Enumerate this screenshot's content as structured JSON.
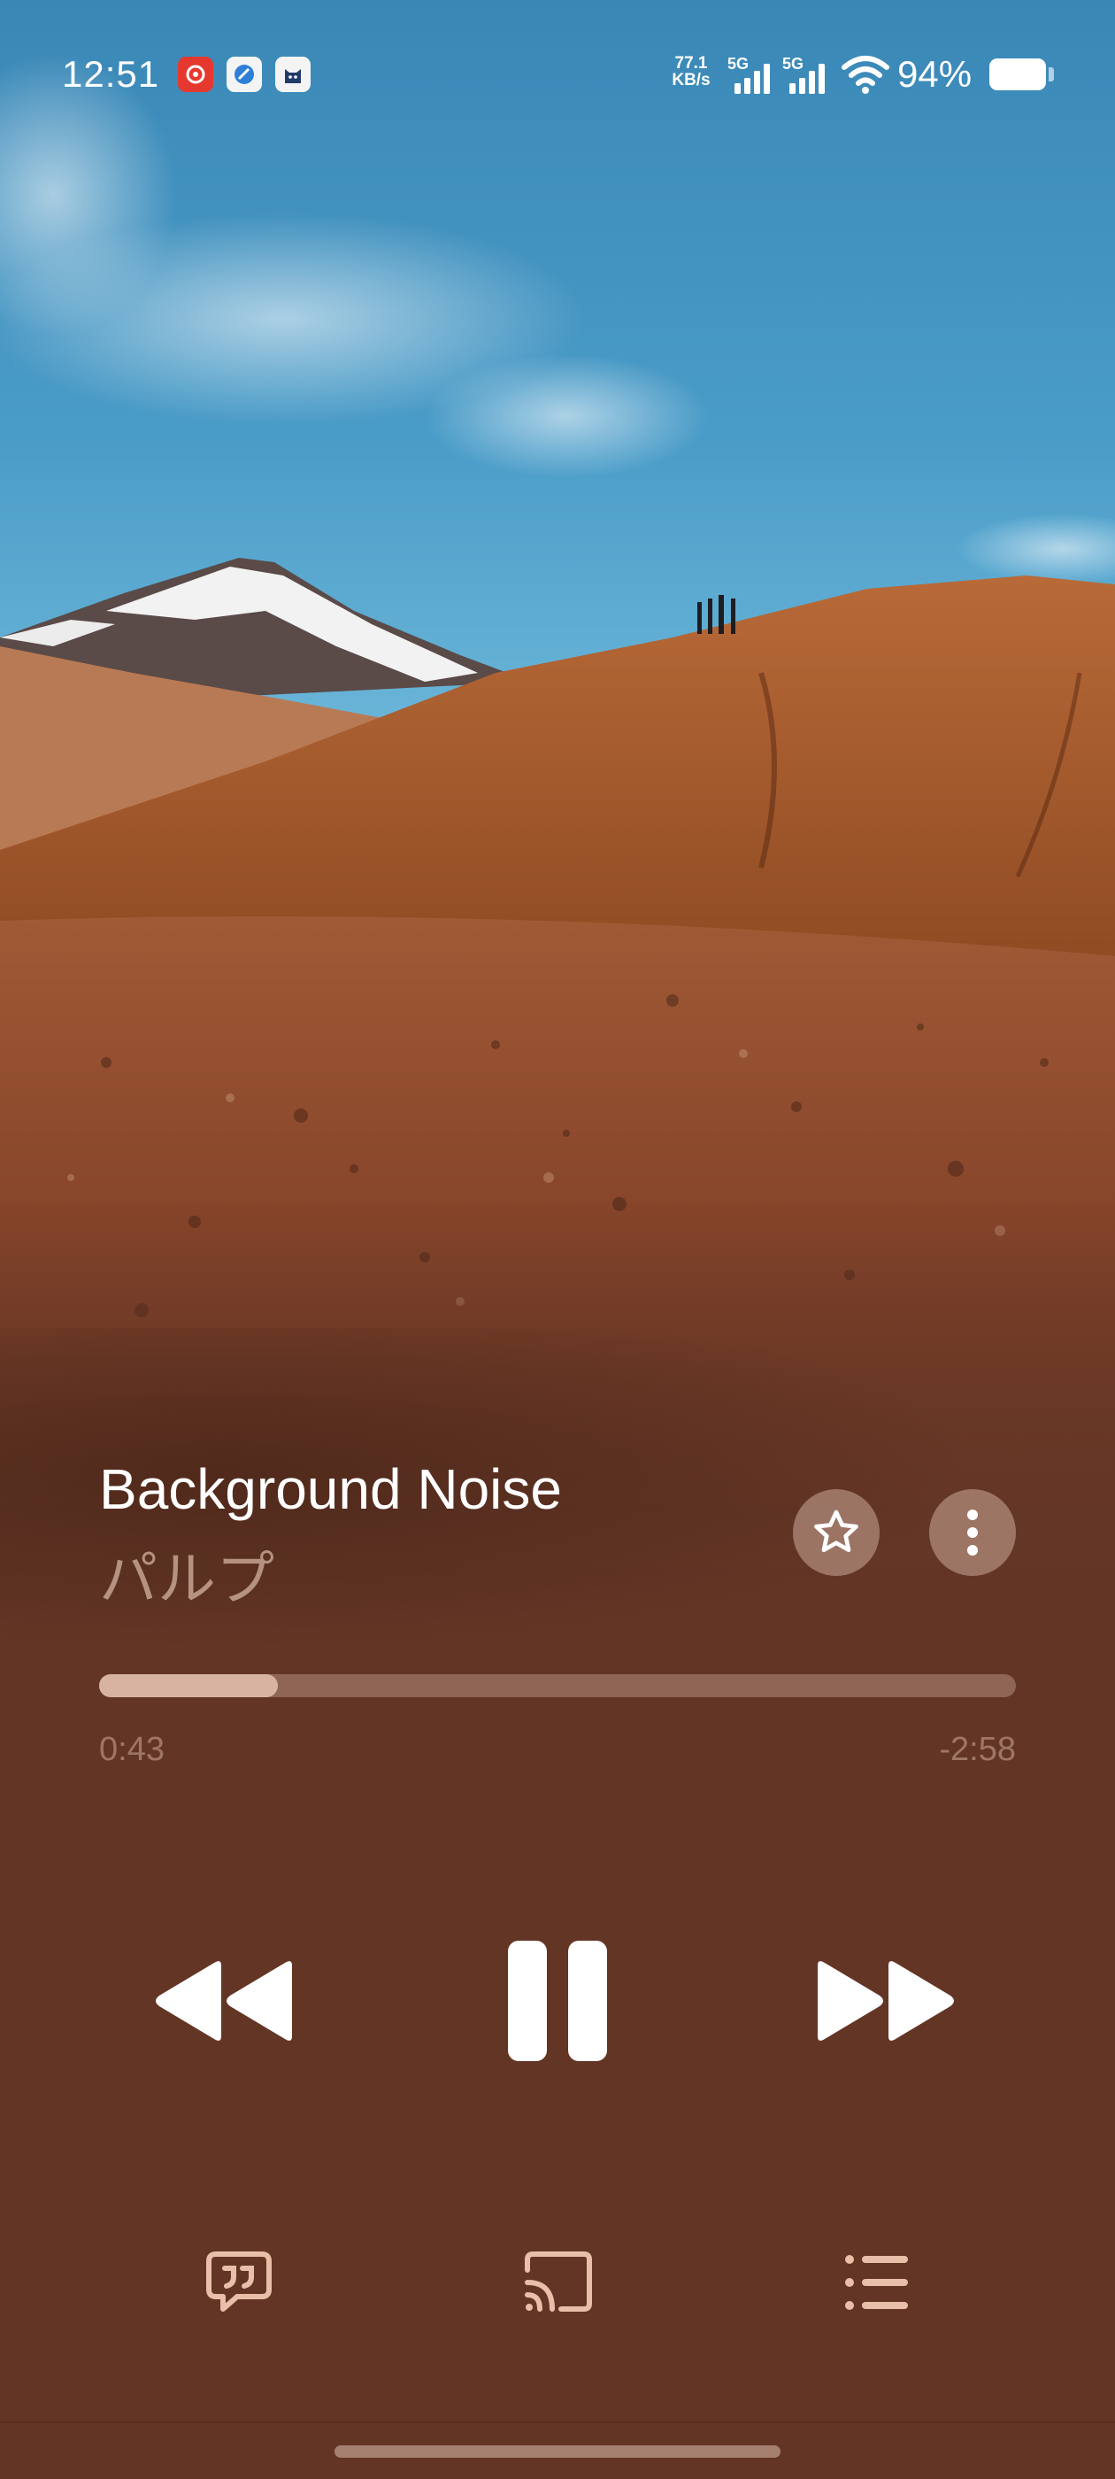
{
  "status_bar": {
    "time": "12:51",
    "notification_icons": [
      "netease-music-icon",
      "browser-icon",
      "cat-app-icon"
    ],
    "net_speed_value": "77.1",
    "net_speed_unit": "KB/s",
    "sim1_label": "5G",
    "sim2_label": "5G",
    "battery_percent": "94%"
  },
  "artwork": {
    "icon": "album-art-image"
  },
  "track": {
    "title": "Background Noise",
    "artist": "パルプ"
  },
  "progress": {
    "elapsed": "0:43",
    "remaining": "-2:58",
    "fraction": 0.195
  },
  "controls": {
    "favorite_icon": "star-outline-icon",
    "more_icon": "more-vertical-icon",
    "previous_icon": "rewind-icon",
    "play_pause_icon": "pause-icon",
    "next_icon": "fast-forward-icon"
  },
  "bottom_actions": {
    "lyrics_icon": "lyrics-quote-icon",
    "cast_icon": "cast-icon",
    "queue_icon": "queue-list-icon"
  },
  "colors": {
    "background": "#643625",
    "accent_fill": "#d8b3a1",
    "icon_tint": "#e8bfa8"
  }
}
